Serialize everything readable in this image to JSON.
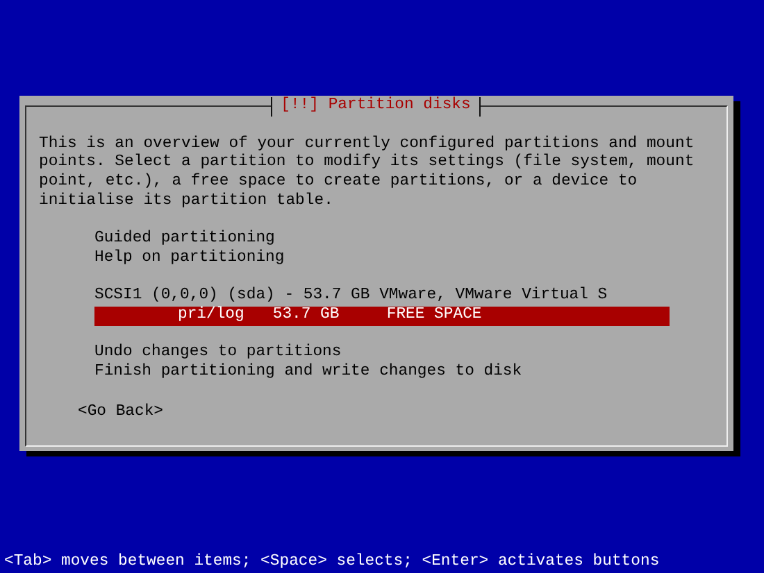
{
  "dialog": {
    "title": "[!!] Partition disks",
    "description": "This is an overview of your currently configured partitions and mount points. Select a partition to modify its settings (file system, mount point, etc.), a free space to create partitions, or a device to initialise its partition table.",
    "menu_groups": [
      [
        {
          "label": "Guided partitioning",
          "selected": false
        },
        {
          "label": "Help on partitioning",
          "selected": false
        }
      ],
      [
        {
          "label": "SCSI1 (0,0,0) (sda) - 53.7 GB VMware, VMware Virtual S",
          "selected": false
        },
        {
          "label": "pri/log   53.7 GB     FREE SPACE",
          "selected": true
        }
      ],
      [
        {
          "label": "Undo changes to partitions",
          "selected": false
        },
        {
          "label": "Finish partitioning and write changes to disk",
          "selected": false
        }
      ]
    ],
    "buttons": [
      "<Go Back>"
    ]
  },
  "status_bar": "<Tab> moves between items; <Space> selects; <Enter> activates buttons"
}
